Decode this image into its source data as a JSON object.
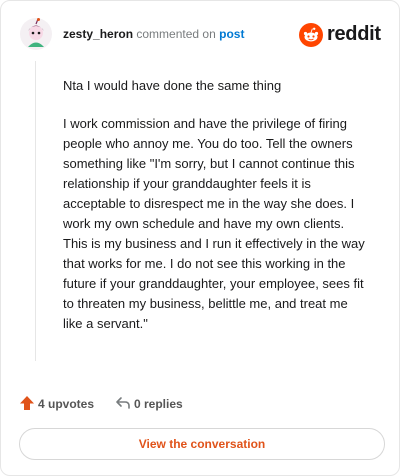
{
  "header": {
    "username": "zesty_heron",
    "action_text": "commented on",
    "target_link": "post",
    "brand_name": "reddit",
    "brand_icon": "reddit-snoo-icon",
    "brand_color": "#ff4500"
  },
  "comment": {
    "paragraphs": [
      "Nta I would have done the same thing",
      "I work commission and have the privilege of firing people who annoy me. You do too. Tell the owners something like \"I'm sorry, but I cannot continue this relationship if your granddaughter feels it is acceptable to disrespect me in the way she does. I work my own schedule and have my own clients. This is my business and I run it effectively in the way that works for me. I do not see this working in the future if your granddaughter, your employee, sees fit to threaten my business, belittle me, and treat me like a servant.\""
    ]
  },
  "actions": {
    "upvotes_label": "4 upvotes",
    "upvote_icon": "upvote-arrow-icon",
    "replies_label": "0 replies",
    "reply_icon": "reply-arrow-icon"
  },
  "cta": {
    "label": "View the conversation"
  },
  "colors": {
    "accent_orange": "#e0531a",
    "link_blue": "#0079d3"
  }
}
